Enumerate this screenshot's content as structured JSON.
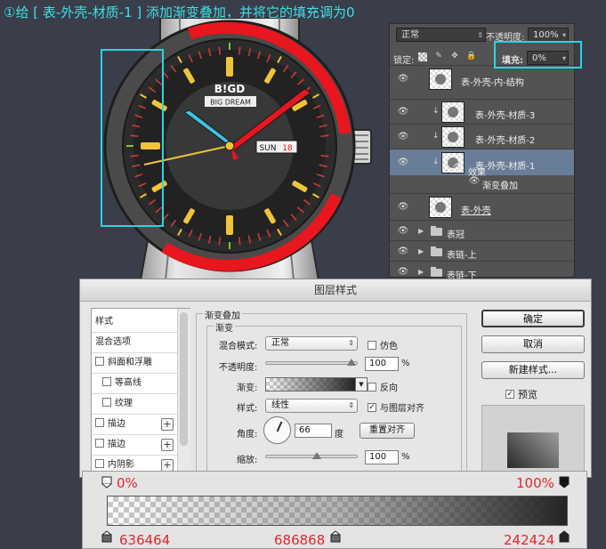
{
  "headline": "①给 [ 表-外壳-材质-1 ] 添加渐变叠加，并将它的填充调为0",
  "colors": {
    "highlight": "#29d6e0",
    "annotation_red": "#e8242f",
    "panel_bg": "#535353",
    "selected_row": "#6a7d98",
    "dialog_bg": "#e6e6e6"
  },
  "watch": {
    "brand": "B!GD",
    "sub_brand": "BIG DREAM",
    "day": "SUN",
    "date": "18"
  },
  "layers_panel": {
    "blend_mode": "正常",
    "opacity_label": "不透明度:",
    "opacity_value": "100%",
    "lock_label": "锁定:",
    "fill_label": "填充:",
    "fill_value": "0%",
    "layers": [
      {
        "name": "表-外壳-内-结构",
        "type": "layer",
        "clipped": false,
        "selected": false
      },
      {
        "name": "表-外壳-材质-3",
        "type": "layer",
        "clipped": true,
        "selected": false
      },
      {
        "name": "表-外壳-材质-2",
        "type": "layer",
        "clipped": true,
        "selected": false
      },
      {
        "name": "表-外壳-材质-1",
        "type": "layer",
        "clipped": true,
        "selected": true
      },
      {
        "name": "效果",
        "type": "effects",
        "clipped": false,
        "selected": false
      },
      {
        "name": "渐变叠加",
        "type": "effect",
        "clipped": false,
        "selected": false
      },
      {
        "name": "表-外壳",
        "type": "layer",
        "clipped": false,
        "selected": false
      },
      {
        "name": "表冠",
        "type": "group",
        "clipped": false,
        "selected": false
      },
      {
        "name": "表链-上",
        "type": "group",
        "clipped": false,
        "selected": false
      },
      {
        "name": "表链-下",
        "type": "group",
        "clipped": false,
        "selected": false
      }
    ]
  },
  "dialog": {
    "title": "图层样式",
    "styles_list": [
      {
        "label": "样式",
        "checkbox": false,
        "plus": false
      },
      {
        "label": "混合选项",
        "checkbox": false,
        "plus": false
      },
      {
        "label": "斜面和浮雕",
        "checkbox": true,
        "plus": false
      },
      {
        "label": "等高线",
        "checkbox": true,
        "plus": false
      },
      {
        "label": "纹理",
        "checkbox": true,
        "plus": false
      },
      {
        "label": "描边",
        "checkbox": true,
        "plus": true
      },
      {
        "label": "描边",
        "checkbox": true,
        "plus": true
      },
      {
        "label": "内阴影",
        "checkbox": true,
        "plus": true
      }
    ],
    "section_title": "渐变叠加",
    "subsection_title": "渐变",
    "blend_mode_label": "混合模式:",
    "blend_mode_value": "正常",
    "dither_label": "仿色",
    "dither_checked": false,
    "opacity_label": "不透明度:",
    "opacity_value": "100",
    "opacity_unit": "%",
    "gradient_label": "渐变:",
    "reverse_label": "反向",
    "reverse_checked": false,
    "style_label": "样式:",
    "style_value": "线性",
    "align_label": "与图层对齐",
    "align_checked": true,
    "angle_label": "角度:",
    "angle_value": "66",
    "angle_unit": "度",
    "reset_align_label": "重置对齐",
    "scale_label": "缩放:",
    "scale_value": "100",
    "scale_unit": "%",
    "ok_label": "确定",
    "cancel_label": "取消",
    "new_style_label": "新建样式...",
    "preview_label": "预览",
    "preview_checked": true
  },
  "gradient_editor": {
    "opacity_left": "0%",
    "opacity_right": "100%",
    "color_left": "636464",
    "color_mid": "686868",
    "color_right": "242424"
  }
}
